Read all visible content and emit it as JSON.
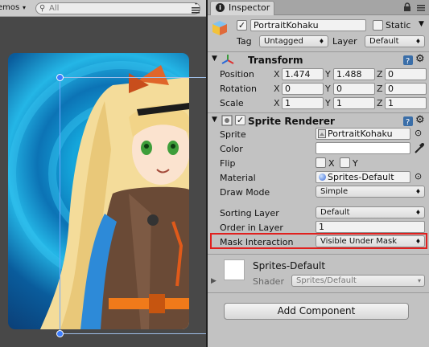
{
  "scene": {
    "gizmos_label": "emos",
    "search_placeholder": "All"
  },
  "inspector": {
    "tab_label": "Inspector",
    "object": {
      "name": "PortraitKohaku",
      "static_label": "Static",
      "tag_label": "Tag",
      "tag_value": "Untagged",
      "layer_label": "Layer",
      "layer_value": "Default"
    },
    "transform": {
      "title": "Transform",
      "rows": [
        {
          "label": "Position",
          "x": "1.474",
          "y": "1.488",
          "z": "0"
        },
        {
          "label": "Rotation",
          "x": "0",
          "y": "0",
          "z": "0"
        },
        {
          "label": "Scale",
          "x": "1",
          "y": "1",
          "z": "1"
        }
      ],
      "axis_x": "X",
      "axis_y": "Y",
      "axis_z": "Z"
    },
    "sprite_renderer": {
      "title": "Sprite Renderer",
      "sprite_label": "Sprite",
      "sprite_value": "PortraitKohaku",
      "color_label": "Color",
      "flip_label": "Flip",
      "flip_x": "X",
      "flip_y": "Y",
      "material_label": "Material",
      "material_value": "Sprites-Default",
      "draw_mode_label": "Draw Mode",
      "draw_mode_value": "Simple",
      "sorting_layer_label": "Sorting Layer",
      "sorting_layer_value": "Default",
      "order_in_layer_label": "Order in Layer",
      "order_in_layer_value": "1",
      "mask_interaction_label": "Mask Interaction",
      "mask_interaction_value": "Visible Under Mask"
    },
    "material_preview": {
      "name": "Sprites-Default",
      "shader_label": "Shader",
      "shader_value": "Sprites/Default"
    },
    "add_component_label": "Add Component"
  },
  "colors": {
    "highlight_border": "#e0201e",
    "selection_blue": "#3b7dff"
  },
  "icons": [
    "search-icon",
    "menu-icon",
    "lock-icon",
    "cube-icon",
    "gear-icon",
    "help-icon",
    "sprite-icon",
    "eyedropper-icon",
    "object-picker-icon"
  ]
}
